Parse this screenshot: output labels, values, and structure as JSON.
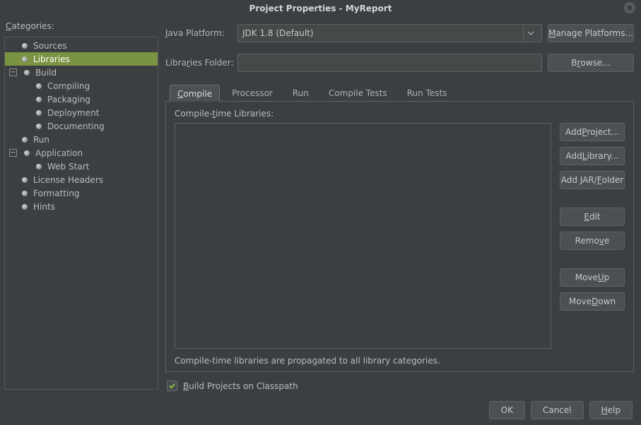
{
  "window": {
    "title": "Project Properties - MyReport"
  },
  "categories": {
    "label_pre": "C",
    "label_post": "ategories:",
    "tree": {
      "sources": "Sources",
      "libraries": "Libraries",
      "build": "Build",
      "compiling": "Compiling",
      "packaging": "Packaging",
      "deployment": "Deployment",
      "documenting": "Documenting",
      "run": "Run",
      "application": "Application",
      "webstart": "Web Start",
      "license": "License Headers",
      "formatting": "Formatting",
      "hints": "Hints"
    }
  },
  "form": {
    "java_platform_pre": "J",
    "java_platform_post": "ava Platform:",
    "java_platform_value": "JDK 1.8 (Default)",
    "manage_u": "M",
    "manage_post": "anage Platforms...",
    "libfolder_pre": "Libra",
    "libfolder_u": "r",
    "libfolder_post": "ies Folder:",
    "libfolder_value": "",
    "browse_pre": "B",
    "browse_u": "r",
    "browse_post": "owse..."
  },
  "tabs": {
    "compile_u": "C",
    "compile_post": "ompile",
    "processor": "Processor",
    "run": "Run",
    "compile_tests": "Compile Tests",
    "run_tests": "Run Tests"
  },
  "compile": {
    "label_pre": "Compile-",
    "label_u": "t",
    "label_post": "ime Libraries:",
    "add_project_pre": "Add ",
    "add_project_u": "P",
    "add_project_post": "roject...",
    "add_library_pre": "Add ",
    "add_library_u": "L",
    "add_library_post": "ibrary...",
    "add_jar_pre": "Add JAR/",
    "add_jar_u": "F",
    "add_jar_post": "older",
    "edit_u": "E",
    "edit_post": "dit",
    "remove_pre": "Remo",
    "remove_u": "v",
    "remove_post": "e",
    "moveup_pre": "Move ",
    "moveup_u": "U",
    "moveup_post": "p",
    "movedown_pre": "Move ",
    "movedown_u": "D",
    "movedown_post": "own",
    "propagate": "Compile-time libraries are propagated to all library categories."
  },
  "checkbox": {
    "pre": "B",
    "post": "uild Projects on Classpath"
  },
  "footer": {
    "ok": "OK",
    "cancel": "Cancel",
    "help_u": "H",
    "help_post": "elp"
  }
}
